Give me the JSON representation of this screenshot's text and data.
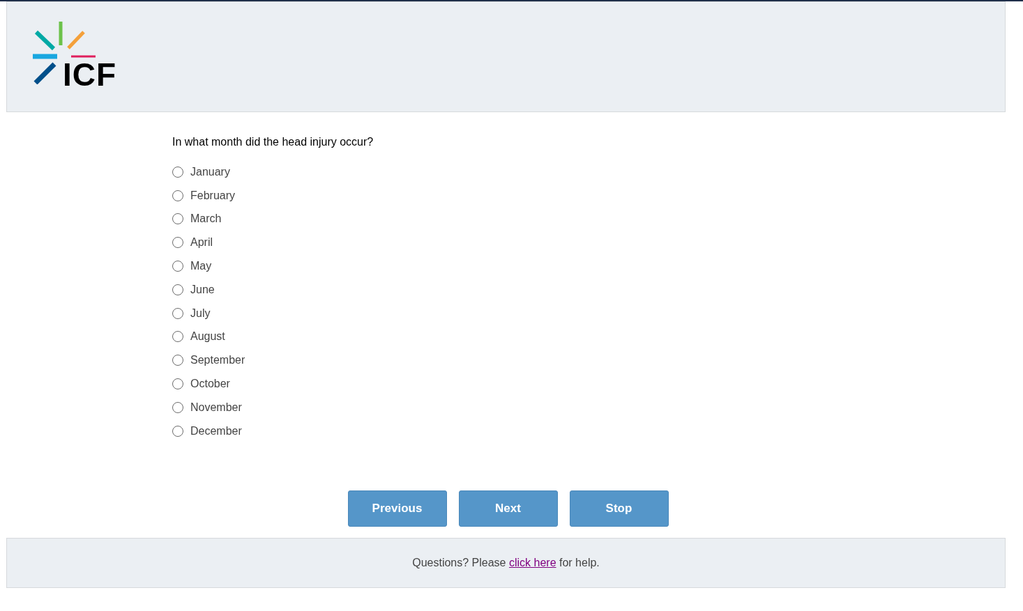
{
  "header": {
    "logo_text": "ICF"
  },
  "question": {
    "text": "In what month did the head injury occur?",
    "options": [
      {
        "label": "January",
        "selected": false
      },
      {
        "label": "February",
        "selected": false
      },
      {
        "label": "March",
        "selected": false
      },
      {
        "label": "April",
        "selected": false
      },
      {
        "label": "May",
        "selected": false
      },
      {
        "label": "June",
        "selected": false
      },
      {
        "label": "July",
        "selected": false
      },
      {
        "label": "August",
        "selected": false
      },
      {
        "label": "September",
        "selected": false
      },
      {
        "label": "October",
        "selected": false
      },
      {
        "label": "November",
        "selected": false
      },
      {
        "label": "December",
        "selected": false
      }
    ]
  },
  "buttons": [
    "Previous",
    "Next",
    "Stop"
  ],
  "footer": {
    "prefix": "Questions? Please ",
    "link": "click here",
    "suffix": " for help."
  }
}
